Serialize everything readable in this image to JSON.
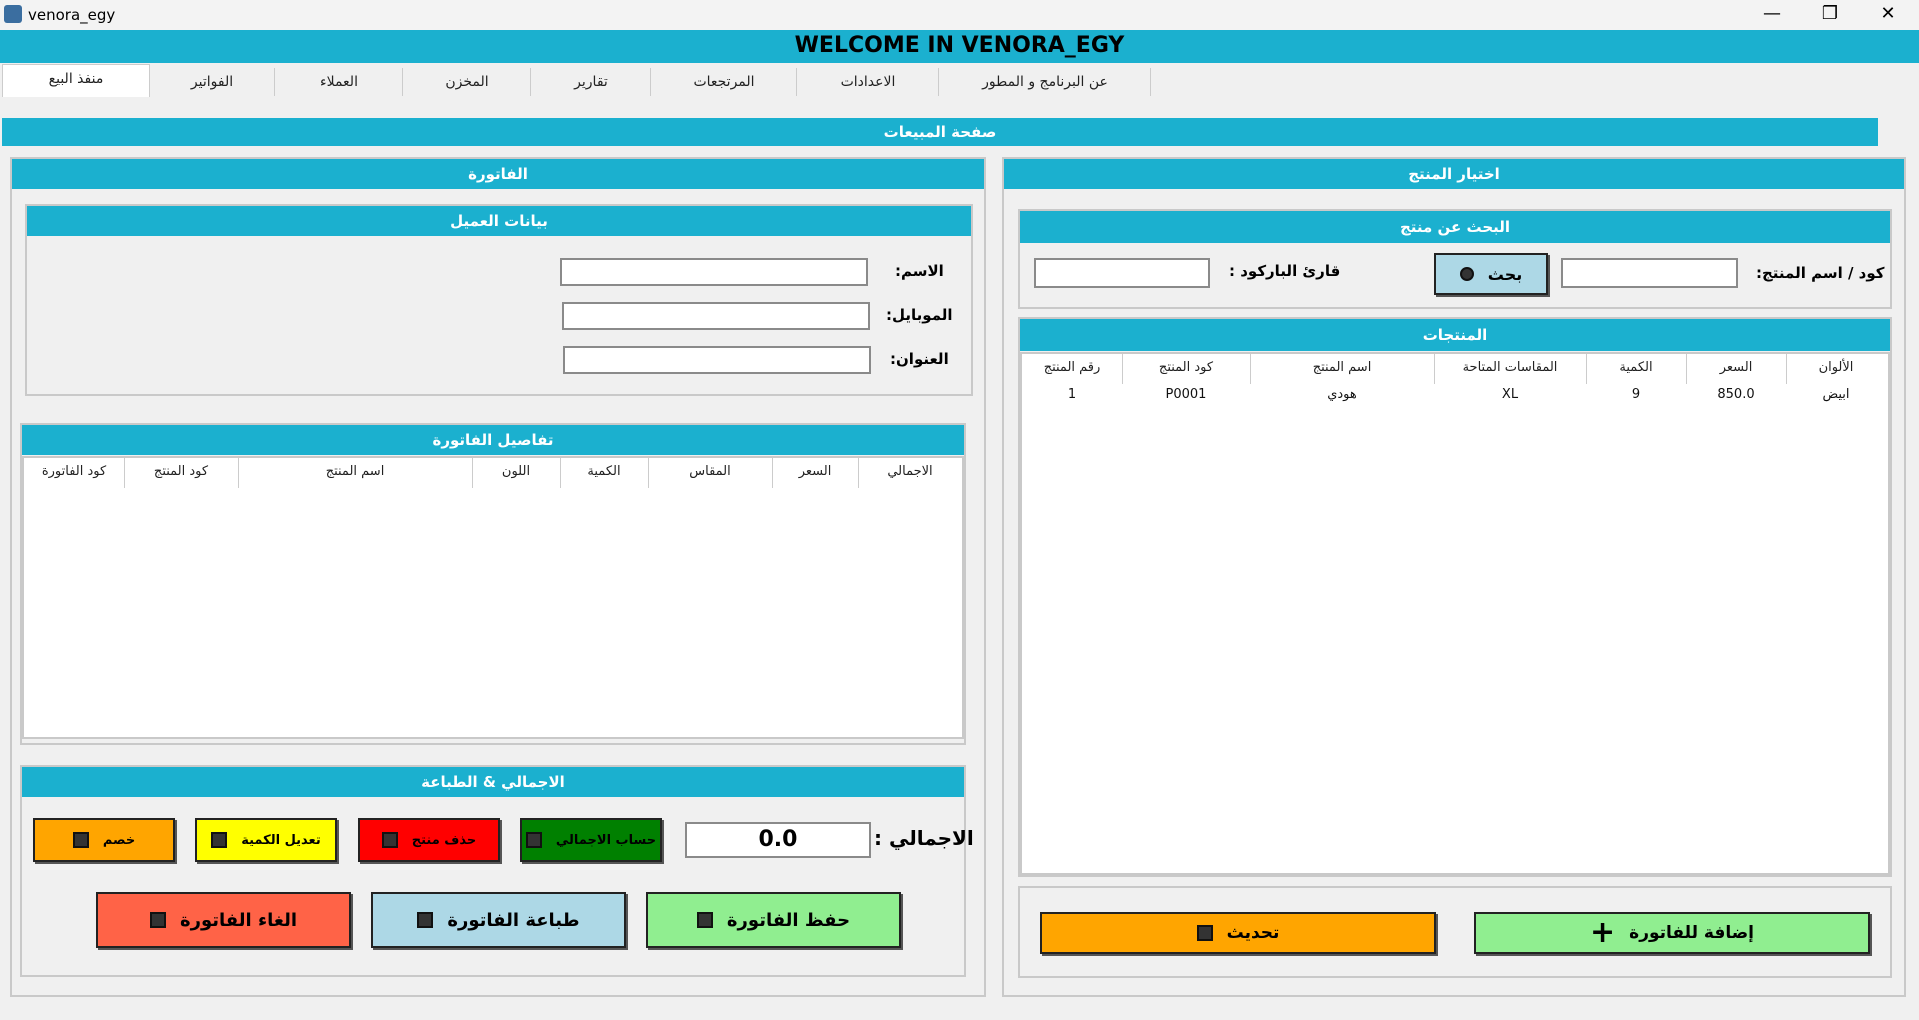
{
  "window": {
    "title": "venora_egy",
    "minimize": "—",
    "maximize": "❐",
    "close": "✕"
  },
  "banner": "WELCOME IN VENORA_EGY",
  "tabs": [
    "منفذ البيع",
    "الفواتير",
    "العملاء",
    "المخزن",
    "تقارير",
    "المرتجعات",
    "الاعدادات",
    "عن البرنامج و المطور"
  ],
  "page_title": "صفحة المبيعات",
  "invoice": {
    "title": "الفاتورة",
    "customer": {
      "title": "بيانات العميل",
      "name_label": "الاسم:",
      "mobile_label": "الموبايل:",
      "address_label": "العنوان:",
      "name_value": "",
      "mobile_value": "",
      "address_value": ""
    },
    "details": {
      "title": "تفاصيل الفاتورة",
      "columns": [
        "الاجمالي",
        "السعر",
        "المقاس",
        "الكمية",
        "اللون",
        "اسم المنتج",
        "كود المنتج",
        "كود الفاتورة"
      ]
    },
    "totals": {
      "title": "الاجمالي & الطباعة",
      "total_label": "الاجمالي :",
      "total_value": "0.0",
      "calc_total": "حساب الاجمالي",
      "delete_product": "حذف منتج",
      "edit_qty": "تعديل الكمية",
      "discount": "خصم",
      "save_invoice": "حفظ الفاتورة",
      "print_invoice": "طباعة الفاتورة",
      "cancel_invoice": "الغاء الفاتورة"
    }
  },
  "product": {
    "title": "اختيار المنتج",
    "search": {
      "title": "البحث عن منتج",
      "code_label": "كود / اسم المنتج:",
      "search_button": "بحث",
      "barcode_label": "قارئ الباركود :",
      "code_value": "",
      "barcode_value": ""
    },
    "products": {
      "title": "المنتجات",
      "columns": [
        "الألوان",
        "السعر",
        "الكمية",
        "المقاسات المتاحة",
        "اسم المنتج",
        "كود المنتج",
        "رقم المنتج"
      ],
      "rows": [
        [
          "ابيض",
          "850.0",
          "9",
          "XL",
          "هودي",
          "P0001",
          "1"
        ]
      ]
    },
    "add_button": "إضافة للفاتورة",
    "refresh_button": "تحديث"
  },
  "colors": {
    "accent": "#1bb0cf",
    "green": "#008000",
    "red": "#ff0000",
    "yellow": "#ffff00",
    "orange": "#ffa500",
    "light_green": "#90ee90",
    "light_blue": "#add8e6",
    "salmon": "#ff6347"
  }
}
